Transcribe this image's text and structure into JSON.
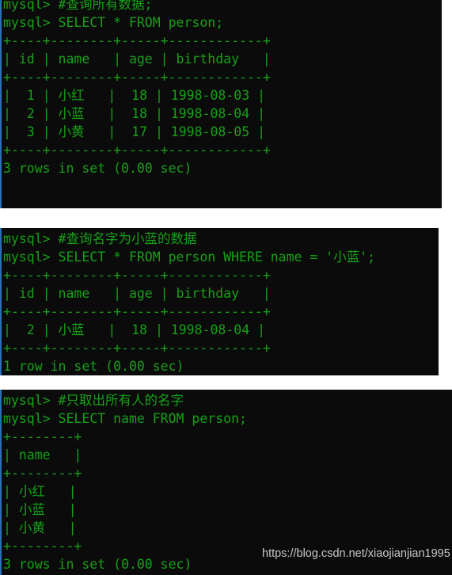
{
  "theme": {
    "page_background": "#ffffff",
    "terminal_background": "#0b0b0b",
    "terminal_text": "#17a017",
    "terminal_left_border": "#2b6fb8",
    "watermark_color": "#c9c9c9"
  },
  "watermark": {
    "text": "https://blog.csdn.net/xiaojianjian1995"
  },
  "blocks": [
    {
      "name": "select-all-rows",
      "lines": [
        "mysql> #查询所有数据;",
        "mysql> SELECT * FROM person;",
        "+----+--------+-----+------------+",
        "| id | name   | age | birthday   |",
        "+----+--------+-----+------------+",
        "|  1 | 小红   |  18 | 1998-08-03 |",
        "|  2 | 小蓝   |  18 | 1998-08-04 |",
        "|  3 | 小黄   |  17 | 1998-08-05 |",
        "+----+--------+-----+------------+",
        "3 rows in set (0.00 sec)"
      ],
      "comment": "#查询所有数据;",
      "query": "SELECT * FROM person;",
      "status": "3 rows in set (0.00 sec)",
      "columns": [
        "id",
        "name",
        "age",
        "birthday"
      ],
      "rows": [
        [
          "1",
          "小红",
          "18",
          "1998-08-03"
        ],
        [
          "2",
          "小蓝",
          "18",
          "1998-08-04"
        ],
        [
          "3",
          "小黄",
          "17",
          "1998-08-05"
        ]
      ]
    },
    {
      "name": "select-where-name",
      "lines": [
        "mysql> #查询名字为小蓝的数据",
        "mysql> SELECT * FROM person WHERE name = '小蓝';",
        "+----+--------+-----+------------+",
        "| id | name   | age | birthday   |",
        "+----+--------+-----+------------+",
        "|  2 | 小蓝   |  18 | 1998-08-04 |",
        "+----+--------+-----+------------+",
        "1 row in set (0.00 sec)"
      ],
      "comment": "#查询名字为小蓝的数据",
      "query": "SELECT * FROM person WHERE name = '小蓝';",
      "status": "1 row in set (0.00 sec)",
      "columns": [
        "id",
        "name",
        "age",
        "birthday"
      ],
      "rows": [
        [
          "2",
          "小蓝",
          "18",
          "1998-08-04"
        ]
      ]
    },
    {
      "name": "select-name-column",
      "lines": [
        "mysql> #只取出所有人的名字",
        "mysql> SELECT name FROM person;",
        "+--------+",
        "| name   |",
        "+--------+",
        "| 小红   |",
        "| 小蓝   |",
        "| 小黄   |",
        "+--------+",
        "3 rows in set (0.00 sec)"
      ],
      "comment": "#只取出所有人的名字",
      "query": "SELECT name FROM person;",
      "status": "3 rows in set (0.00 sec)",
      "columns": [
        "name"
      ],
      "rows": [
        [
          "小红"
        ],
        [
          "小蓝"
        ],
        [
          "小黄"
        ]
      ]
    }
  ]
}
